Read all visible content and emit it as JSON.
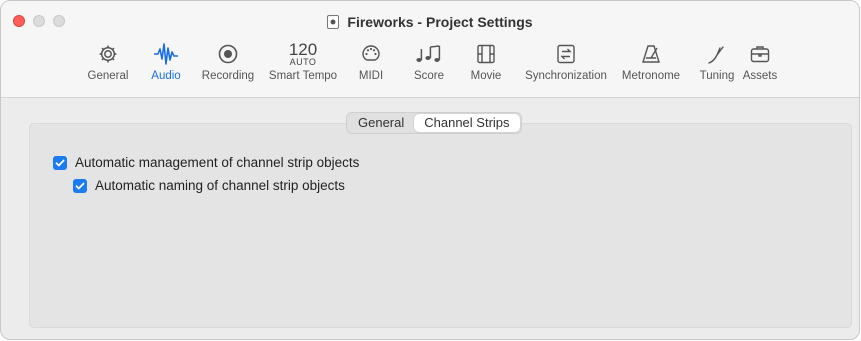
{
  "window": {
    "title": "Fireworks - Project Settings"
  },
  "toolbar": {
    "items": [
      {
        "label": "General",
        "icon": "gear-icon"
      },
      {
        "label": "Audio",
        "icon": "waveform-icon",
        "active": true
      },
      {
        "label": "Recording",
        "icon": "record-icon"
      },
      {
        "label": "Smart Tempo",
        "icon": "tempo-icon",
        "tempo": "120",
        "tempo_mode": "AUTO"
      },
      {
        "label": "MIDI",
        "icon": "midi-icon"
      },
      {
        "label": "Score",
        "icon": "notes-icon"
      },
      {
        "label": "Movie",
        "icon": "film-icon"
      },
      {
        "label": "Synchronization",
        "icon": "sync-icon"
      },
      {
        "label": "Metronome",
        "icon": "metronome-icon"
      },
      {
        "label": "Tuning",
        "icon": "tuning-icon"
      },
      {
        "label": "Assets",
        "icon": "briefcase-icon"
      }
    ]
  },
  "tabs": {
    "general": "General",
    "channel_strips": "Channel Strips",
    "selected": "channel_strips"
  },
  "options": {
    "auto_management": {
      "label": "Automatic management of channel strip objects",
      "checked": true
    },
    "auto_naming": {
      "label": "Automatic naming of channel strip objects",
      "checked": true
    }
  },
  "colors": {
    "accent": "#1a7cf0",
    "close": "#ff5f57"
  }
}
